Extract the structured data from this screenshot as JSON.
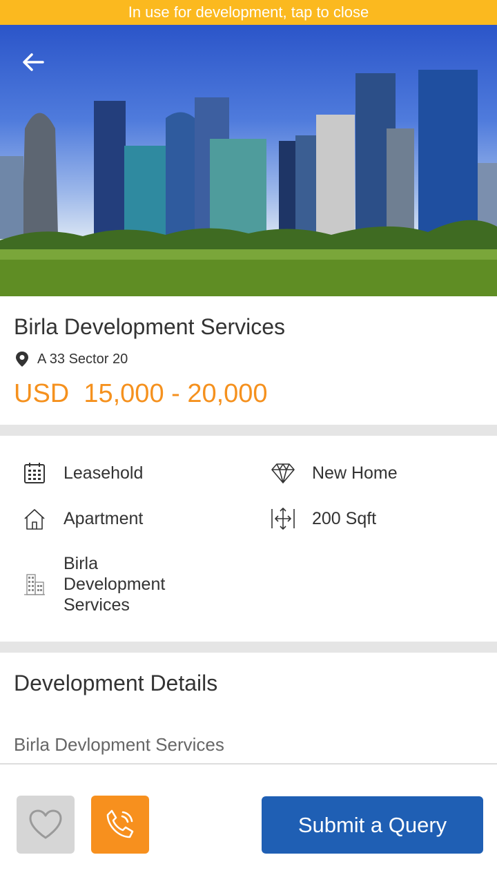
{
  "dev_banner": {
    "text": "In use for development, tap to close"
  },
  "hero": {
    "image_alt": "City skyline with green park",
    "back_icon": "arrow-left-icon"
  },
  "summary": {
    "title": "Birla Development Services",
    "location_icon": "map-pin-icon",
    "address": "A 33 Sector 20",
    "price": "USD  15,000 - 20,000",
    "accent_color": "#f5911e"
  },
  "features": [
    {
      "icon": "calendar-icon",
      "label": "Leasehold"
    },
    {
      "icon": "diamond-icon",
      "label": "New Home"
    },
    {
      "icon": "house-icon",
      "label": "Apartment"
    },
    {
      "icon": "move-arrows-icon",
      "label": "200 Sqft"
    },
    {
      "icon": "building-icon",
      "label": "Birla\nDevelopment\nServices"
    }
  ],
  "details": {
    "title": "Development Details",
    "text": "Birla Devlopment Services"
  },
  "actions": {
    "favorite_icon": "heart-icon",
    "call_icon": "phone-call-icon",
    "submit_label": "Submit a Query",
    "call_color": "#f7901e",
    "submit_color": "#1f5fb4"
  }
}
